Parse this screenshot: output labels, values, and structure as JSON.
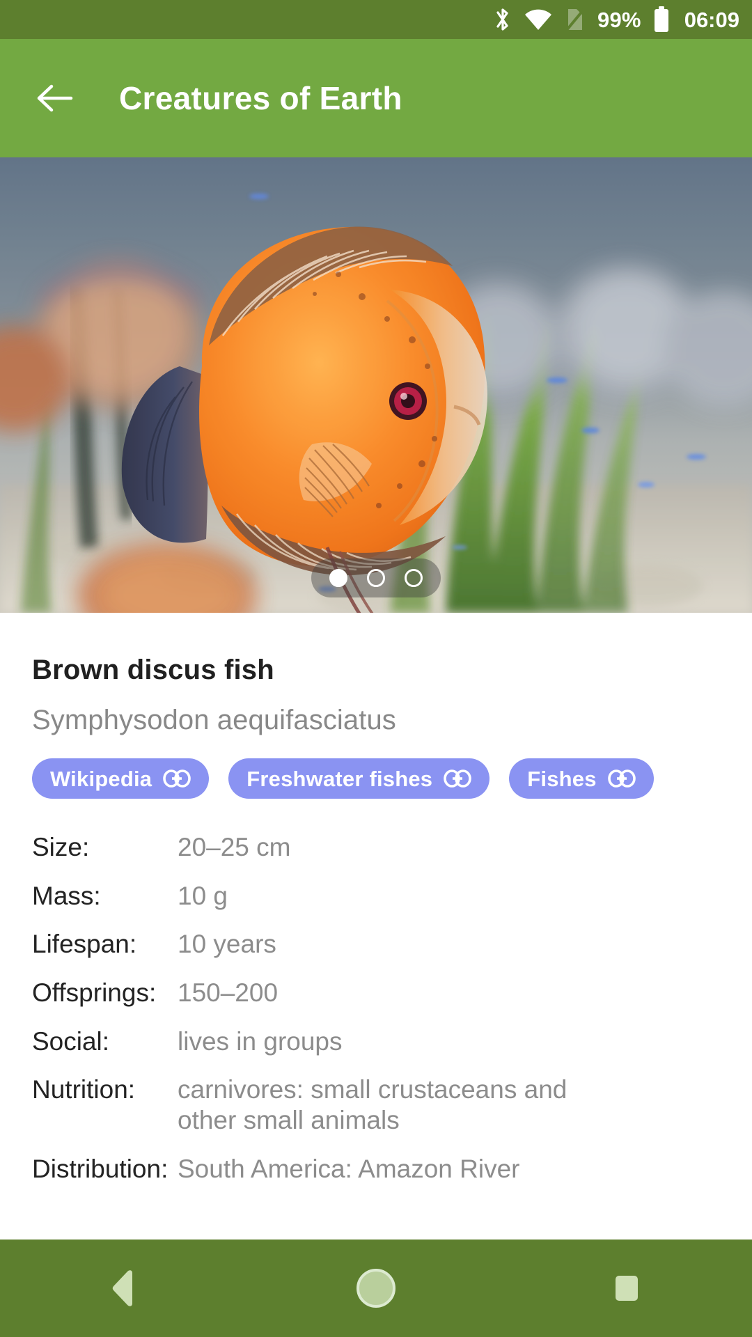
{
  "status_bar": {
    "icons": [
      "bluetooth-icon",
      "wifi-icon",
      "sim-off-icon",
      "battery-icon"
    ],
    "battery_percent": "99%",
    "clock": "06:09",
    "background_color": "#5d7f2e"
  },
  "app_bar": {
    "back_label": "back-arrow",
    "title": "Creatures of Earth",
    "background_color": "#73a942"
  },
  "hero": {
    "alt": "Orange brown discus fish swimming in a planted aquarium",
    "carousel": {
      "total": 3,
      "active_index": 0,
      "dot_labels": [
        "1",
        "2",
        "3"
      ]
    }
  },
  "detail": {
    "common_name": "Brown discus fish",
    "scientific_name": "Symphysodon aequifasciatus",
    "chips": [
      {
        "label": "Wikipedia",
        "icon": "link-icon",
        "color": "#8a93f2"
      },
      {
        "label": "Freshwater fishes",
        "icon": "link-icon",
        "color": "#8a93f2"
      },
      {
        "label": "Fishes",
        "icon": "link-icon",
        "color": "#8a93f2"
      }
    ],
    "facts": [
      {
        "label": "Size:",
        "value": "20–25 cm"
      },
      {
        "label": "Mass:",
        "value": "10 g"
      },
      {
        "label": "Lifespan:",
        "value": "10 years"
      },
      {
        "label": "Offsprings:",
        "value": "150–200"
      },
      {
        "label": "Social:",
        "value": "lives in groups"
      },
      {
        "label": "Nutrition:",
        "value": "carnivores: small crustaceans and other small animals"
      },
      {
        "label": "Distribution:",
        "value": "South America: Amazon River"
      }
    ]
  },
  "nav_bar": {
    "buttons": [
      "back-triangle",
      "home-circle",
      "recents-square"
    ],
    "background_color": "#5d7f2e"
  }
}
